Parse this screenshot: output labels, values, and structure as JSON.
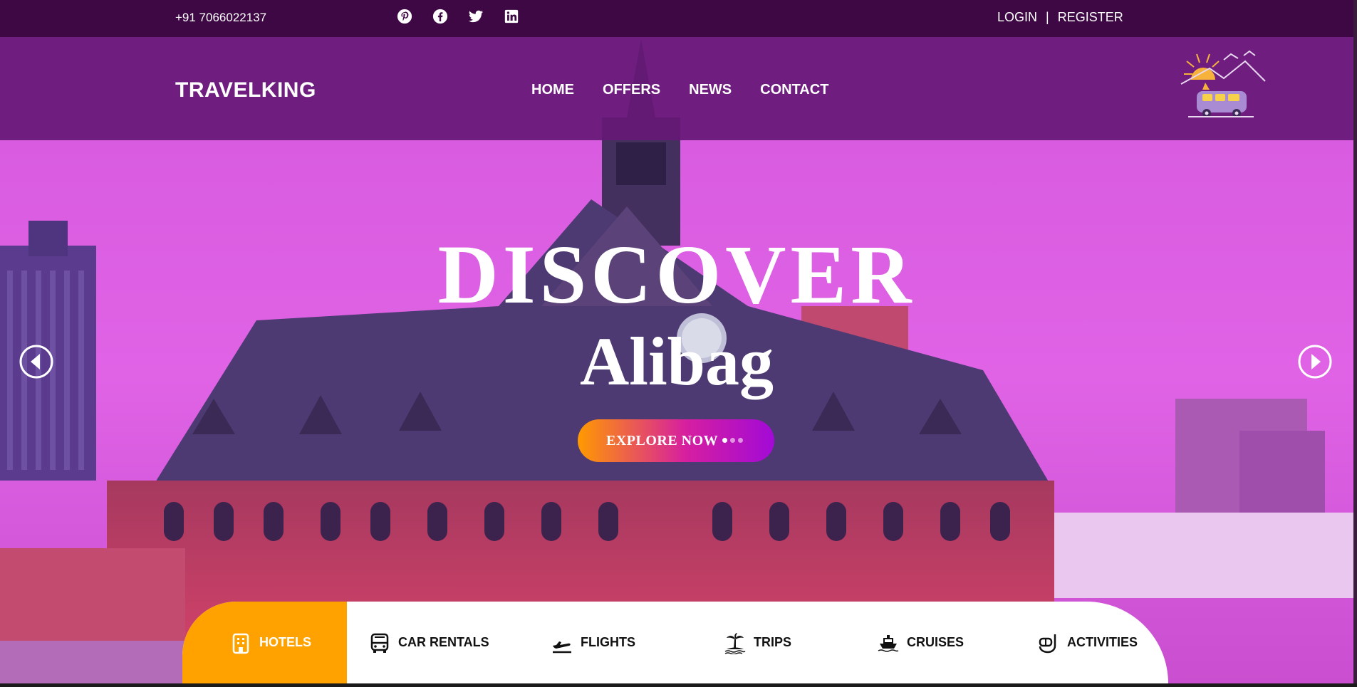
{
  "topbar": {
    "phone": "+91 7066022137",
    "socials": [
      "pinterest-icon",
      "facebook-icon",
      "twitter-icon",
      "linkedin-icon"
    ],
    "login_label": "LOGIN",
    "separator": "|",
    "register_label": "REGISTER"
  },
  "navbar": {
    "brand": "TRAVELKING",
    "menu": [
      "HOME",
      "OFFERS",
      "NEWS",
      "CONTACT"
    ]
  },
  "hero": {
    "title": "DISCOVER",
    "subtitle": "Alibag",
    "cta_label": "EXPLORE NOW",
    "slide_count": 3,
    "active_slide": 1
  },
  "categories": {
    "items": [
      {
        "label": "HOTELS",
        "icon": "hotel-icon",
        "active": true
      },
      {
        "label": "CAR RENTALS",
        "icon": "bus-icon",
        "active": false
      },
      {
        "label": "FLIGHTS",
        "icon": "airplane-icon",
        "active": false
      },
      {
        "label": "TRIPS",
        "icon": "palm-island-icon",
        "active": false
      },
      {
        "label": "CRUISES",
        "icon": "ship-icon",
        "active": false
      },
      {
        "label": "ACTIVITIES",
        "icon": "snorkel-icon",
        "active": false
      }
    ]
  },
  "colors": {
    "topbar": "#3d0844",
    "navbar": "#661976",
    "accent_orange": "#ffa200",
    "sky": "#dc5ce4",
    "cta_gradient": [
      "#ff9a00",
      "#d61fa0",
      "#a20ad6"
    ]
  }
}
